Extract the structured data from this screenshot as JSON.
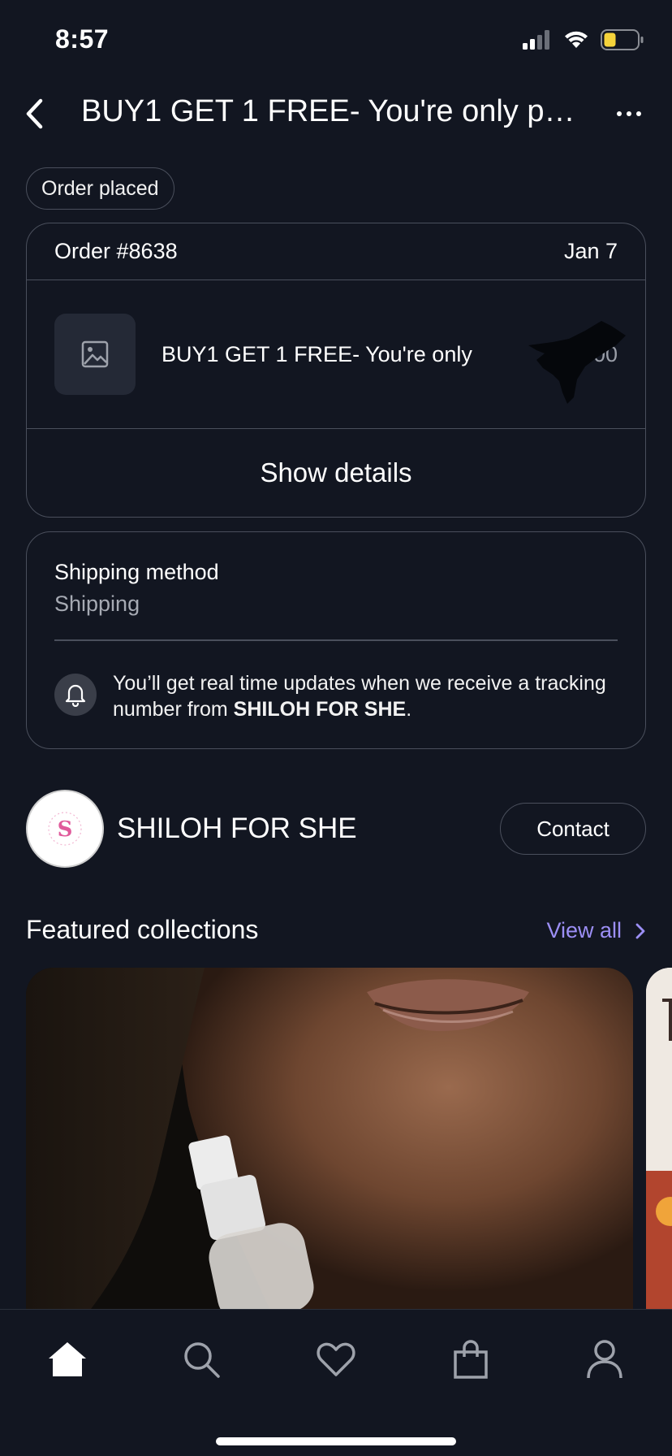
{
  "status_bar": {
    "time": "8:57"
  },
  "header": {
    "title": "BUY1 GET 1 FREE-  You're only pa..."
  },
  "order_status_chip": "Order placed",
  "order": {
    "number": "Order #8638",
    "date": "Jan 7",
    "item_name": "BUY1 GET 1 FREE-  You're only",
    "item_price": "$37.00",
    "show_details_label": "Show details"
  },
  "shipping": {
    "title": "Shipping method",
    "method": "Shipping",
    "notice_prefix": "You’ll get real time updates when we receive a tracking number from ",
    "notice_store": "SHILOH FOR SHE",
    "notice_suffix": "."
  },
  "store": {
    "name": "SHILOH FOR SHE",
    "logo_letter": "S",
    "contact_label": "Contact"
  },
  "featured": {
    "title": "Featured collections",
    "view_all_label": "View all"
  },
  "tabs": [
    {
      "name": "home",
      "icon": "home-icon",
      "active": true
    },
    {
      "name": "search",
      "icon": "search-icon",
      "active": false
    },
    {
      "name": "favorites",
      "icon": "heart-icon",
      "active": false
    },
    {
      "name": "cart",
      "icon": "bag-icon",
      "active": false
    },
    {
      "name": "account",
      "icon": "user-icon",
      "active": false
    }
  ],
  "colors": {
    "background": "#121621",
    "border": "#4a4f5c",
    "accent_link": "#9c8ff6",
    "muted_text": "#a6aab3",
    "brand_pink": "#e05a9b"
  }
}
